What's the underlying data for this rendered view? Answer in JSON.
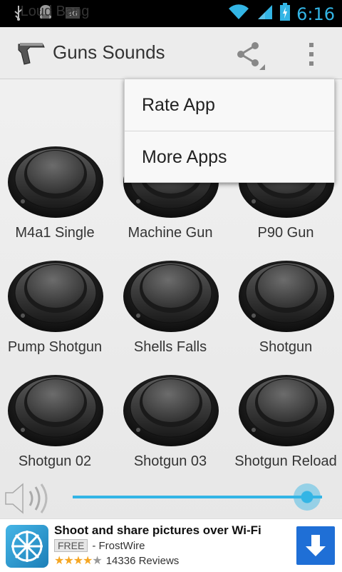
{
  "status_bar": {
    "time": "6:16"
  },
  "action_bar": {
    "title": "Guns Sounds"
  },
  "grid": [
    {
      "label": "Loud Bang",
      "partial": true
    },
    {
      "label": "M4a1 Single"
    },
    {
      "label": "Machine Gun"
    },
    {
      "label": "P90 Gun"
    },
    {
      "label": "Pump Shotgun"
    },
    {
      "label": "Shells Falls"
    },
    {
      "label": "Shotgun"
    },
    {
      "label": "Shotgun 02"
    },
    {
      "label": "Shotgun 03"
    },
    {
      "label": "Shotgun Reload"
    }
  ],
  "menu": {
    "items": [
      {
        "label": "Rate App"
      },
      {
        "label": "More Apps"
      }
    ]
  },
  "volume": {
    "level": 0.94
  },
  "ad": {
    "title": "Shoot and share pictures over Wi-Fi",
    "badge": "FREE",
    "publisher": "- FrostWire",
    "rating": 3.5,
    "reviews": "14336 Reviews"
  },
  "colors": {
    "accent": "#33b5e5",
    "download": "#1f6fd6",
    "stars": "#f5a623"
  },
  "icons": [
    "usb-icon",
    "android-debug-icon",
    "3g-icon",
    "wifi-icon",
    "signal-icon",
    "battery-icon",
    "pistol-icon",
    "share-icon",
    "overflow-menu-icon",
    "speaker-icon",
    "download-icon"
  ]
}
